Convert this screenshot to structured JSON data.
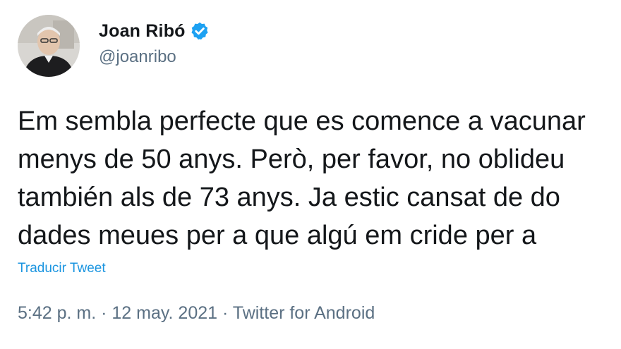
{
  "author": {
    "display_name": "Joan Ribó",
    "handle": "@joanribo",
    "verified_icon": "verified-badge-icon",
    "verified_color": "#1da1f2"
  },
  "tweet": {
    "lines": [
      "Em sembla perfecte que es comence a vacunar",
      "menys de 50 anys. Però, per favor, no oblideu",
      "también als de 73 anys. Ja estic cansat de do",
      "dades meues per a que algú em cride per a"
    ],
    "translate_label": "Traducir Tweet"
  },
  "meta": {
    "time": "5:42 p. m.",
    "separator1": " · ",
    "date": "12 may. 2021",
    "separator2": " · ",
    "source": "Twitter for Android"
  },
  "colors": {
    "text": "#14171a",
    "secondary": "#5b7083",
    "link": "#1b95e0"
  }
}
